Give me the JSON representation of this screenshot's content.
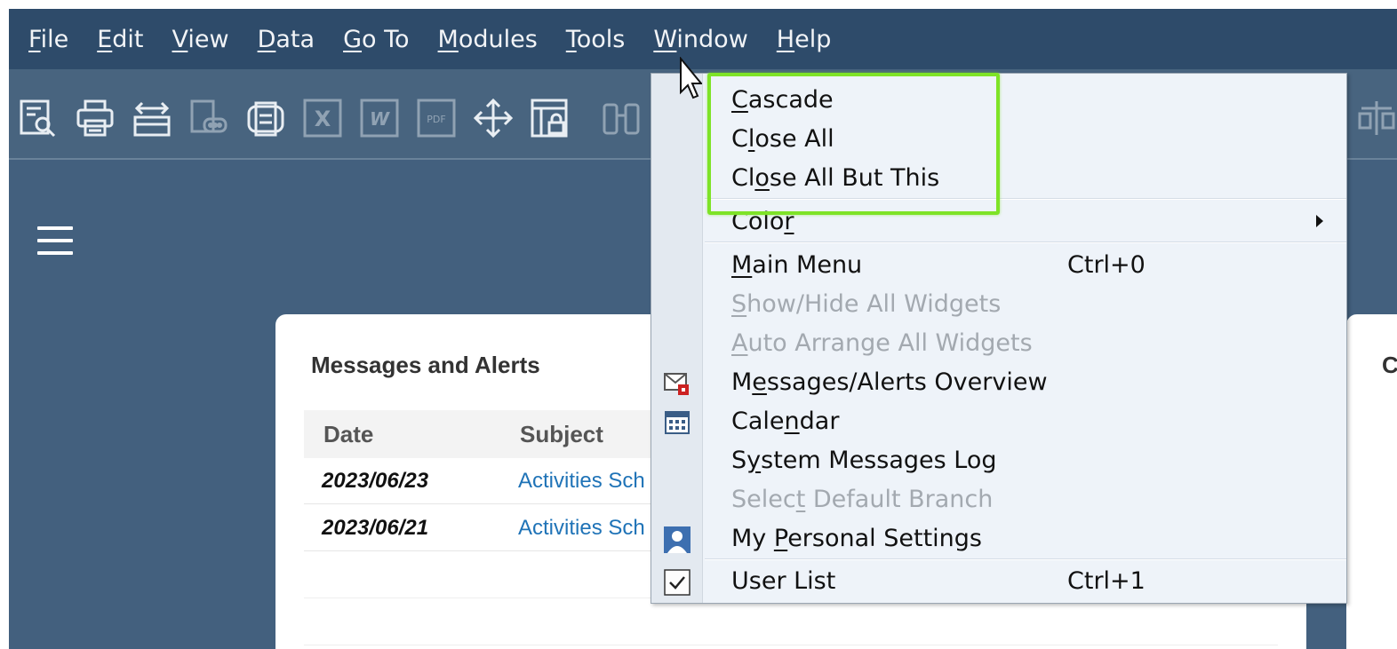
{
  "menubar": {
    "items": [
      {
        "pre": "",
        "u": "F",
        "post": "ile"
      },
      {
        "pre": "",
        "u": "E",
        "post": "dit"
      },
      {
        "pre": "",
        "u": "V",
        "post": "iew"
      },
      {
        "pre": "",
        "u": "D",
        "post": "ata"
      },
      {
        "pre": "",
        "u": "G",
        "post": "o To"
      },
      {
        "pre": "",
        "u": "M",
        "post": "odules"
      },
      {
        "pre": "",
        "u": "T",
        "post": "ools"
      },
      {
        "pre": "",
        "u": "W",
        "post": "indow"
      },
      {
        "pre": "",
        "u": "H",
        "post": "elp"
      }
    ]
  },
  "toolbar": {
    "icons": [
      "print-preview-icon",
      "print-icon",
      "transfer-icon",
      "comment-icon",
      "copy-icon",
      "excel-icon",
      "word-icon",
      "pdf-icon",
      "move-icon",
      "lock-layout-icon",
      "binoculars-icon",
      "balance-icon"
    ],
    "excel_label": "X",
    "word_label": "W",
    "pdf_label": "PDF"
  },
  "messages": {
    "title": "Messages and Alerts",
    "columns": [
      "Date",
      "Subject"
    ],
    "rows": [
      {
        "date": "2023/06/23",
        "subject": "Activities Sch"
      },
      {
        "date": "2023/06/21",
        "subject": "Activities Sch"
      }
    ]
  },
  "second_card": {
    "title_fragment": "C"
  },
  "window_menu": {
    "items": [
      {
        "pre": "",
        "u": "C",
        "post": "ascade",
        "shortcut": "",
        "disabled": false
      },
      {
        "pre": "C",
        "u": "l",
        "post": "ose All",
        "shortcut": "",
        "disabled": false
      },
      {
        "pre": "Cl",
        "u": "o",
        "post": "se All But This",
        "shortcut": "",
        "disabled": false
      },
      {
        "pre": "Colo",
        "u": "r",
        "post": "",
        "shortcut": "",
        "disabled": false,
        "submenu": true
      },
      {
        "pre": "",
        "u": "M",
        "post": "ain Menu",
        "shortcut": "Ctrl+0",
        "disabled": false
      },
      {
        "pre": "",
        "u": "S",
        "post": "how/Hide All Widgets",
        "shortcut": "",
        "disabled": true
      },
      {
        "pre": "",
        "u": "A",
        "post": "uto Arrange All Widgets",
        "shortcut": "",
        "disabled": true
      },
      {
        "pre": "M",
        "u": "e",
        "post": "ssages/Alerts Overview",
        "shortcut": "",
        "disabled": false,
        "icon": "mail-alert-icon"
      },
      {
        "pre": "Cale",
        "u": "n",
        "post": "dar",
        "shortcut": "",
        "disabled": false,
        "icon": "calendar-icon"
      },
      {
        "pre": "S",
        "u": "y",
        "post": "stem Messages Log",
        "shortcut": "",
        "disabled": false
      },
      {
        "pre": "Selec",
        "u": "t",
        "post": " Default Branch",
        "shortcut": "",
        "disabled": true
      },
      {
        "pre": "My ",
        "u": "P",
        "post": "ersonal Settings",
        "shortcut": "",
        "disabled": false,
        "icon": "user-settings-icon"
      },
      {
        "pre": "User List",
        "u": "",
        "post": "",
        "shortcut": "Ctrl+1",
        "disabled": false,
        "icon": "checkbox-checked-icon"
      }
    ]
  },
  "colors": {
    "menubar": "#2e4b6a",
    "toolbar": "#48647f",
    "background": "#43607e",
    "highlight": "#7ee327",
    "link": "#1f73b7"
  }
}
